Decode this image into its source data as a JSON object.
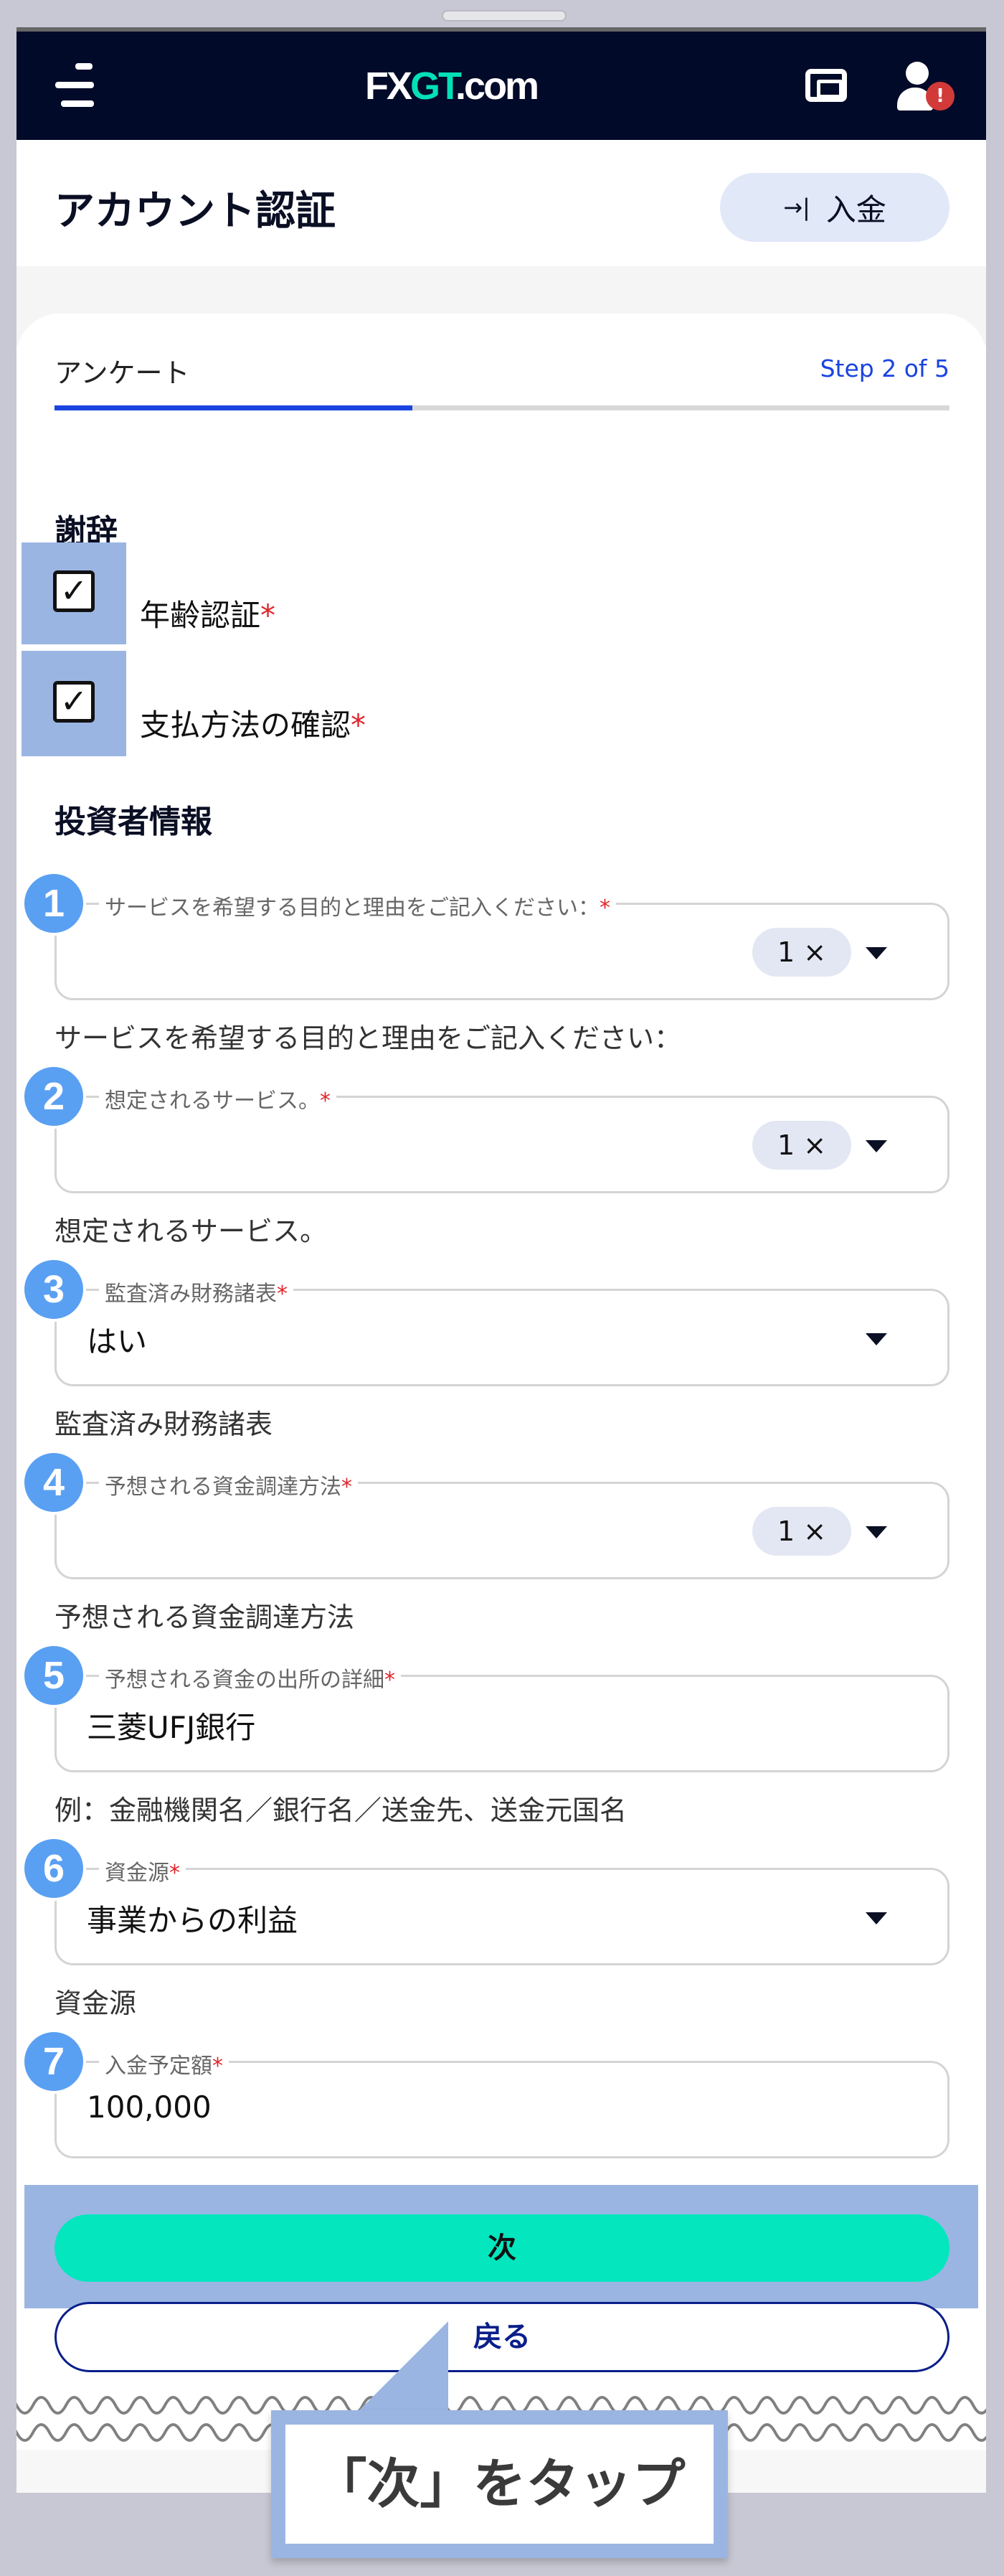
{
  "header": {
    "logo_fx": "FX",
    "logo_gt": "GT",
    "logo_com": ".com",
    "alert_badge": "!"
  },
  "page": {
    "title": "アカウント認証",
    "deposit_label": "入金",
    "deposit_icon": "→|"
  },
  "progress": {
    "tab_label": "アンケート",
    "step_label": "Step 2 of 5",
    "percent": 40
  },
  "acknowledgements": {
    "heading": "謝辞",
    "items": [
      {
        "label": "年齢認証",
        "required": "*",
        "checked": true
      },
      {
        "label": "支払方法の確認",
        "required": "*",
        "checked": true
      }
    ]
  },
  "investor": {
    "heading": "投資者情報",
    "fields": [
      {
        "number": "1",
        "label": "サービスを希望する目的と理由をご記入ください：",
        "required": "*",
        "chip": "1 ×",
        "helper": "サービスを希望する目的と理由をご記入ください："
      },
      {
        "number": "2",
        "label": "想定されるサービス。",
        "required": "*",
        "chip": "1 ×",
        "helper": "想定されるサービス。"
      },
      {
        "number": "3",
        "label": "監査済み財務諸表",
        "required": "*",
        "value": "はい",
        "helper": "監査済み財務諸表"
      },
      {
        "number": "4",
        "label": "予想される資金調達方法",
        "required": "*",
        "chip": "1 ×",
        "helper": "予想される資金調達方法"
      },
      {
        "number": "5",
        "label": "予想される資金の出所の詳細",
        "required": "*",
        "value": "三菱UFJ銀行",
        "helper": "例：金融機関名／銀行名／送金先、送金元国名"
      },
      {
        "number": "6",
        "label": "資金源",
        "required": "*",
        "value": "事業からの利益",
        "helper": "資金源"
      },
      {
        "number": "7",
        "label": "入金予定額",
        "required": "*",
        "value": "100,000"
      }
    ]
  },
  "actions": {
    "next_label": "次",
    "back_label": "戻る"
  },
  "callout": {
    "text": "「次」をタップ"
  },
  "colors": {
    "header": "#010a29",
    "accent": "#03e6be",
    "highlight": "#9bb5e3",
    "badge": "#5aa0f2",
    "step": "#1a44e0"
  }
}
